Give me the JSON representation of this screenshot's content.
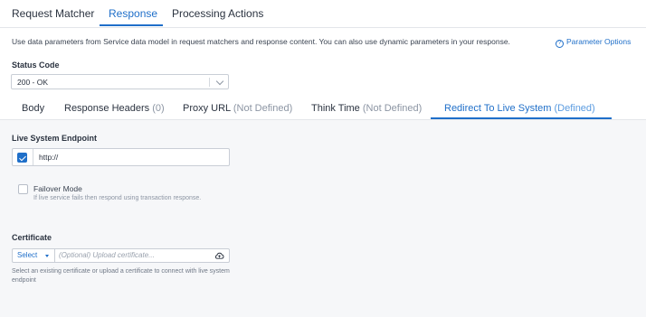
{
  "top_tabs": [
    "Request Matcher",
    "Response",
    "Processing Actions"
  ],
  "info_text": "Use data parameters from Service data model in request matchers and response content. You can also use dynamic parameters in your response.",
  "param_options_link": "Parameter Options",
  "status_code": {
    "label": "Status Code",
    "value": "200 - OK"
  },
  "sub_tabs": [
    {
      "name": "Body",
      "suffix": ""
    },
    {
      "name": "Response Headers",
      "suffix": "(0)"
    },
    {
      "name": "Proxy URL",
      "suffix": "(Not Defined)"
    },
    {
      "name": "Think Time",
      "suffix": "(Not Defined)"
    },
    {
      "name": "Redirect To Live System",
      "suffix": "(Defined)"
    }
  ],
  "live_system": {
    "label": "Live System Endpoint",
    "value": "http://",
    "enabled": true
  },
  "failover": {
    "title": "Failover Mode",
    "description": "If live service fails then respond using transaction response.",
    "checked": false
  },
  "certificate": {
    "label": "Certificate",
    "select_label": "Select",
    "placeholder": "(Optional) Upload certificate...",
    "help": "Select an existing certificate or upload a certificate to connect with live system endpoint"
  },
  "colors": {
    "accent": "#1f6fc9",
    "muted": "#8c95a3"
  }
}
